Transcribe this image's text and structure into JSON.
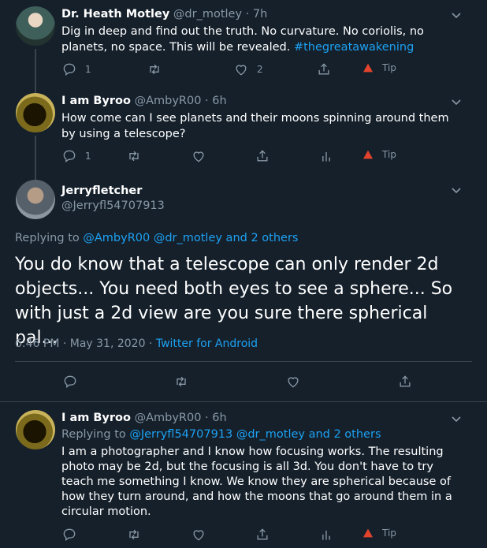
{
  "tweets": [
    {
      "name": "Dr. Heath Motley",
      "handle": "@dr_motley",
      "time": "· 7h",
      "text_main": "Dig in deep and find out the truth. No curvature. No coriolis, no planets, no space. This will be revealed.",
      "hashtag": "#thegreatawakening",
      "reply_count": "1",
      "like_count": "2",
      "tip_label": "Tip"
    },
    {
      "name": "I am Byroo",
      "handle": "@AmbyR00",
      "time": "· 6h",
      "text": "How come can I see planets and their moons spinning around them by using a telescope?",
      "reply_count": "1",
      "tip_label": "Tip"
    }
  ],
  "focused": {
    "name": "Jerryfletcher",
    "handle": "@Jerryfl54707913",
    "replying_to_prefix": "Replying to",
    "replying_to_mentions": "@AmbyR00 @dr_motley and 2 others",
    "text": "You do know that a telescope can only render 2d objects... You need both eyes to see a sphere... So with just a 2d view are you sure there spherical pal...",
    "timestamp": "6:46 PM · May 31, 2020 ·",
    "source": "Twitter for Android"
  },
  "reply": {
    "name": "I am Byroo",
    "handle": "@AmbyR00",
    "time": "· 6h",
    "replying_to_prefix": "Replying to",
    "replying_to_mentions": "@Jerryfl54707913 @dr_motley and 2 others",
    "text": "I am a photographer and I know how focusing works. The resulting photo may be 2d, but the focusing is all 3d. You don't have to try teach me something I know. We know they are spherical because of how they turn around, and how the moons that go around them in a circular motion.",
    "tip_label": "Tip"
  },
  "colors": {
    "background": "#15202b",
    "muted": "#8899a6",
    "link": "#1da1f2",
    "tip_brave": "#e2432c"
  },
  "icons": [
    "reply-icon",
    "retweet-icon",
    "like-icon",
    "share-icon",
    "analytics-icon",
    "brave-tip-icon",
    "chevron-down-icon"
  ]
}
